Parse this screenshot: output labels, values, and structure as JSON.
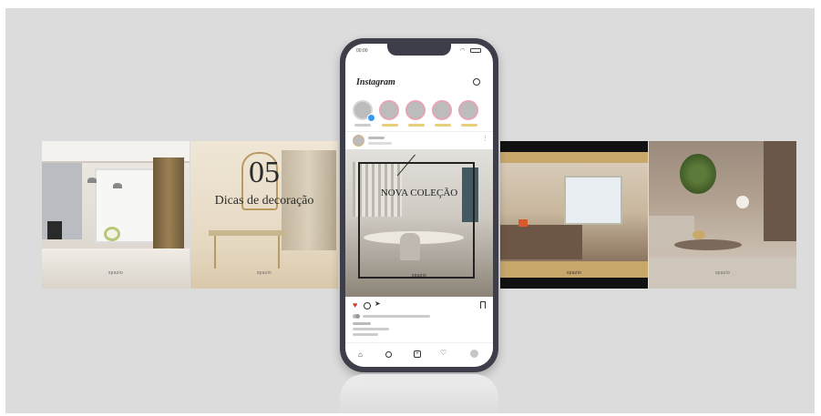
{
  "colors": {
    "background": "#dcdcdc",
    "phone_frame": "#3e3e4a",
    "heart": "#d33a3a",
    "gold": "#c8a76a"
  },
  "phone": {
    "status_time": "00:00",
    "app_name": "Instagram",
    "story_count": 5,
    "icons": {
      "messenger": "messenger-icon",
      "like": "heart-icon",
      "comment": "comment-icon",
      "share": "send-icon",
      "save": "bookmark-icon",
      "home": "home-icon",
      "search": "search-icon",
      "add": "add-post-icon",
      "activity": "activity-heart-icon",
      "profile": "profile-avatar"
    }
  },
  "tiles": [
    {
      "name": "kitchen-photo",
      "brand": "spazio"
    },
    {
      "name": "tips-post",
      "number": "05",
      "caption": "Dicas de decoração",
      "brand": "spazio"
    },
    {
      "name": "new-collection-post",
      "caption": "NOVA COLEÇÃO",
      "brand": "spazio"
    },
    {
      "name": "bedroom-post",
      "brand": "spazio"
    },
    {
      "name": "living-room-photo",
      "brand": "spazio"
    }
  ]
}
